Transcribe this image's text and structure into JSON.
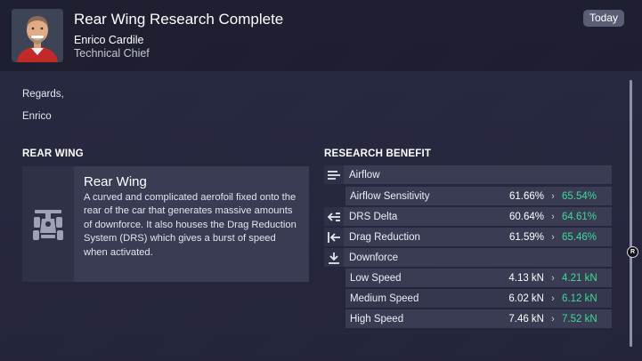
{
  "message": {
    "title": "Rear Wing Research Complete",
    "sender_name": "Enrico Cardile",
    "sender_role": "Technical Chief",
    "date": "Today",
    "greeting": "Regards,",
    "signoff": "Enrico"
  },
  "part": {
    "section_title": "REAR WING",
    "name": "Rear Wing",
    "description": "A curved and complicated aerofoil fixed onto the rear of the car that generates massive amounts of downforce. It also houses the Drag Reduction System (DRS) which gives a burst of speed when activated.",
    "icon": "car-icon"
  },
  "benefit": {
    "section_title": "RESEARCH BENEFIT",
    "categories": [
      {
        "label": "Airflow",
        "icon": "airflow-icon",
        "stats": [
          {
            "label": "Airflow Sensitivity",
            "old": "61.66%",
            "new": "65.54%"
          }
        ]
      },
      {
        "label": "DRS Delta",
        "icon": "drs-arrow-icon",
        "old": "60.64%",
        "new": "64.61%"
      },
      {
        "label": "Drag Reduction",
        "icon": "drag-reduction-icon",
        "old": "61.59%",
        "new": "65.46%"
      },
      {
        "label": "Downforce",
        "icon": "downforce-icon",
        "stats": [
          {
            "label": "Low Speed",
            "old": "4.13 kN",
            "new": "4.21 kN"
          },
          {
            "label": "Medium Speed",
            "old": "6.02 kN",
            "new": "6.12 kN"
          },
          {
            "label": "High Speed",
            "old": "7.46 kN",
            "new": "7.52 kN"
          }
        ]
      }
    ]
  },
  "controls": {
    "r_button": "R"
  },
  "colors": {
    "improved": "#3ddc97",
    "panel": "#3a3c54",
    "header": "#1c1d2e"
  }
}
